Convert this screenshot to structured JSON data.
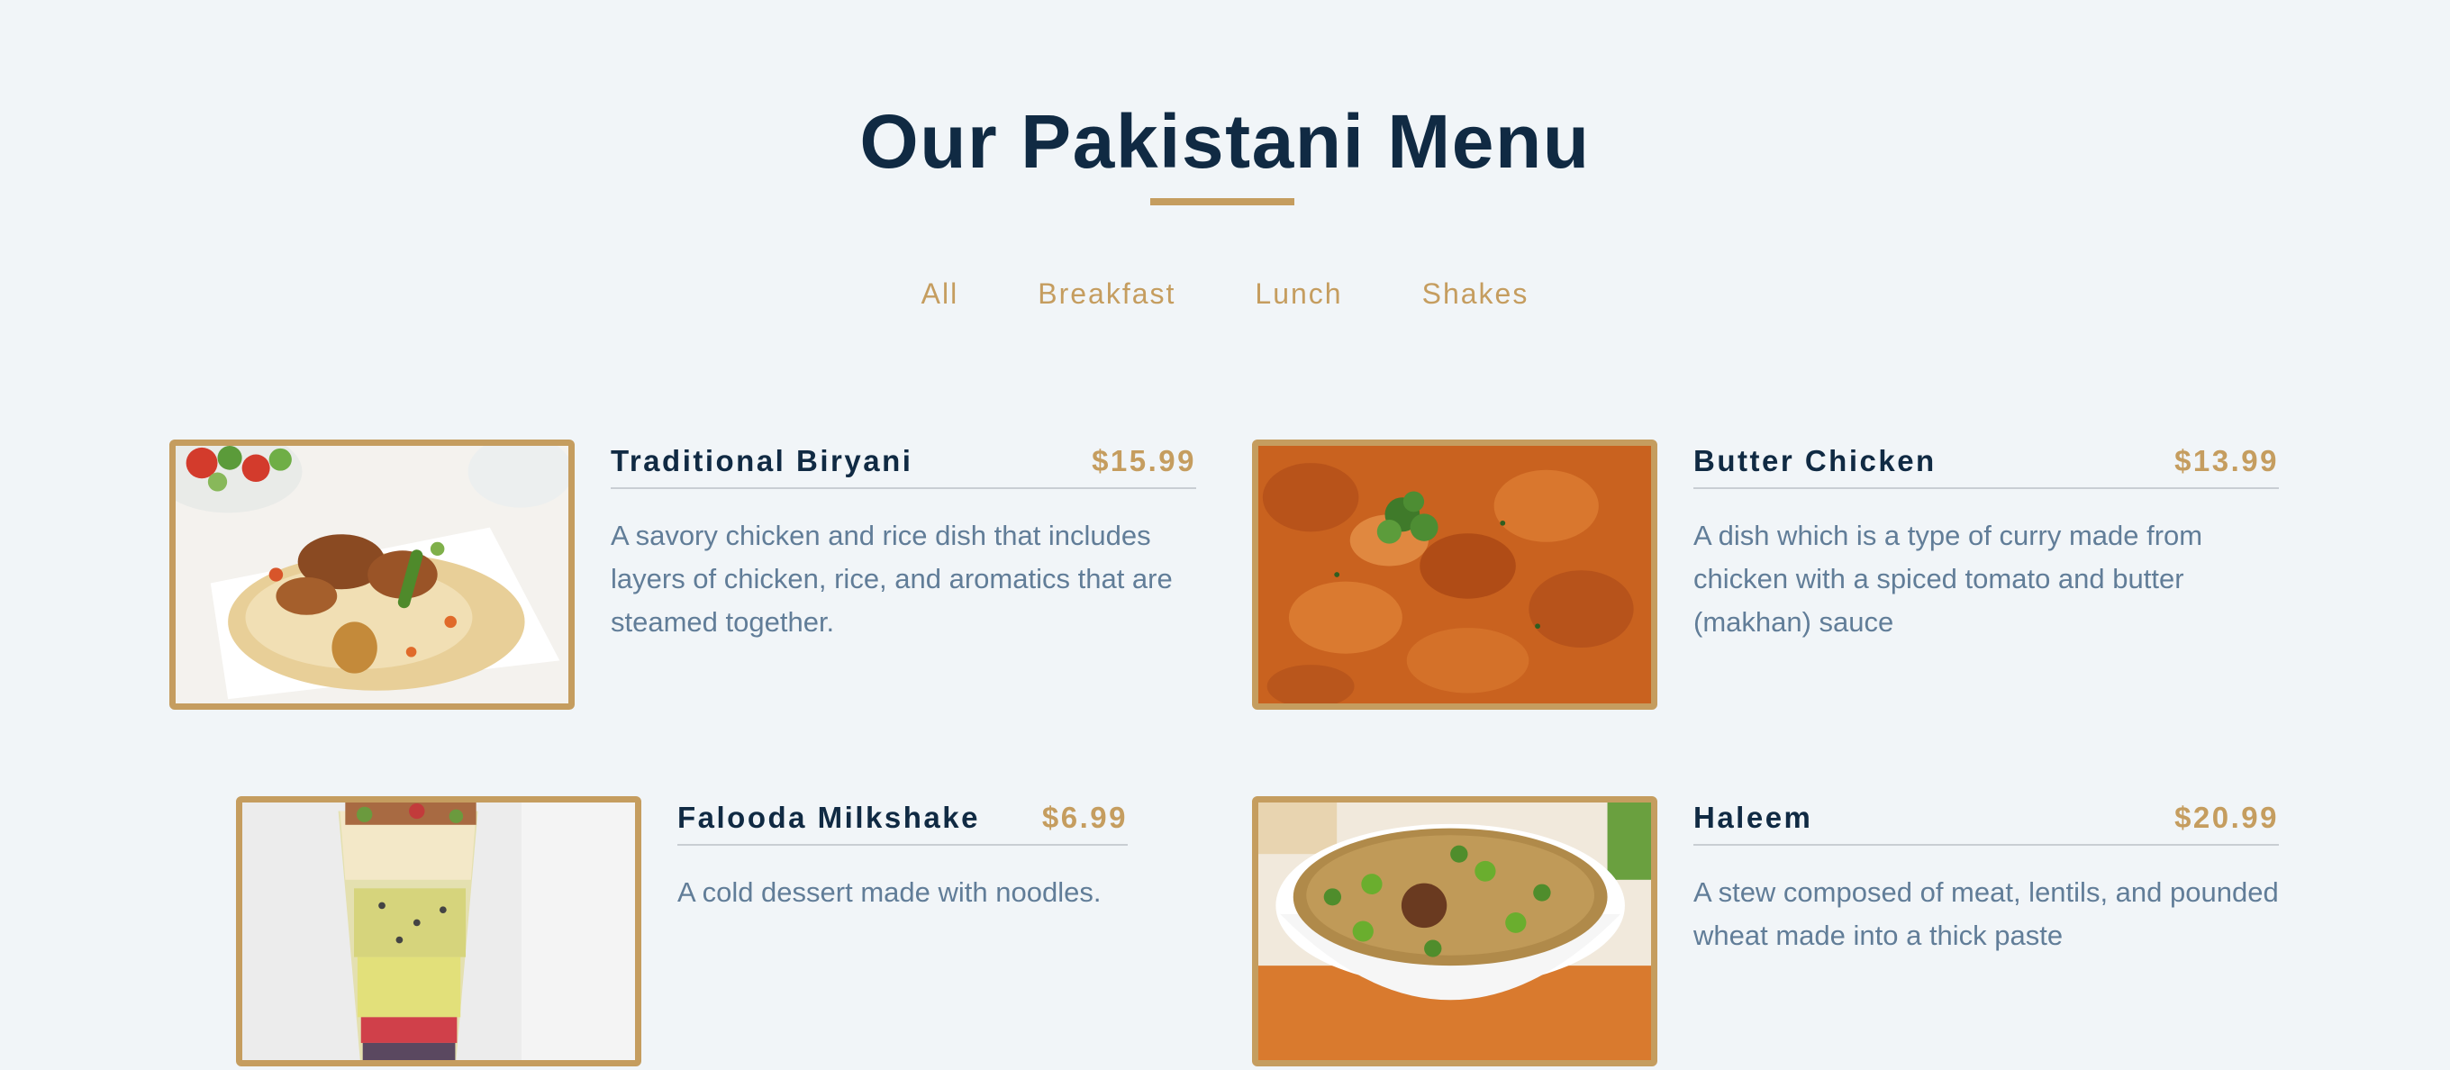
{
  "page": {
    "title": "Our Pakistani Menu"
  },
  "filters": [
    "All",
    "Breakfast",
    "Lunch",
    "Shakes"
  ],
  "items": [
    {
      "name": "Traditional Biryani",
      "price": "$15.99",
      "description": "A savory chicken and rice dish that includes layers of chicken, rice, and aromatics that are steamed together.",
      "image": "biryani-photo"
    },
    {
      "name": "Butter Chicken",
      "price": "$13.99",
      "description": "A dish which is a type of curry made from chicken with a spiced tomato and butter (makhan) sauce",
      "image": "butter-chicken-photo"
    },
    {
      "name": "Falooda Milkshake",
      "price": "$6.99",
      "description": "A cold dessert made with noodles.",
      "image": "falooda-photo"
    },
    {
      "name": "Haleem",
      "price": "$20.99",
      "description": "A stew composed of meat, lentils, and pounded wheat made into a thick paste",
      "image": "haleem-photo"
    }
  ],
  "colors": {
    "accent": "#c59d5f",
    "heading": "#102a43",
    "body_text": "#617d98",
    "background": "#f1f5f8"
  }
}
